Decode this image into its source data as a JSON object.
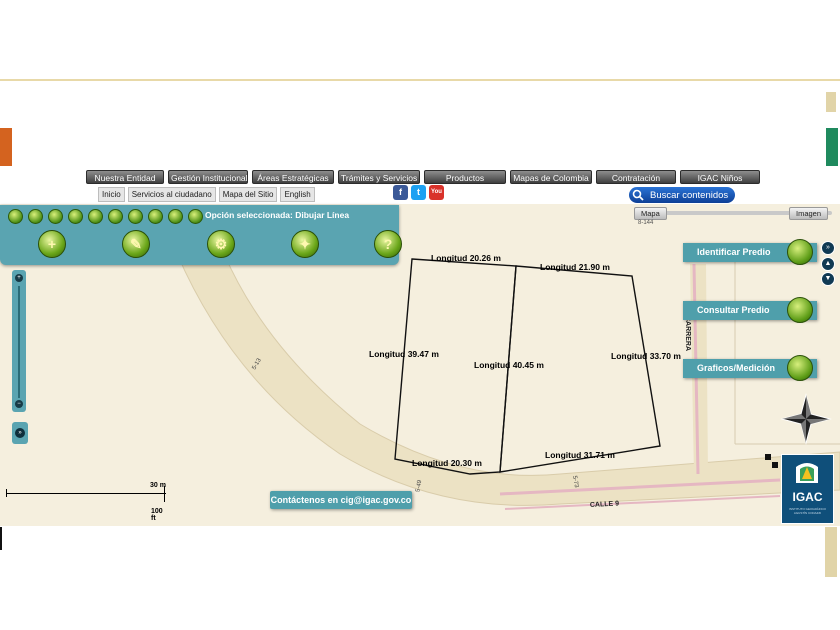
{
  "nav": {
    "items": [
      "Nuestra Entidad",
      "Gestión Institucional",
      "Áreas Estratégicas",
      "Trámites y Servicios",
      "Productos",
      "Mapas de Colombia",
      "Contratación",
      "IGAC Niños"
    ]
  },
  "subnav": {
    "items": [
      "Inicio",
      "Servicios al ciudadano",
      "Mapa del Sitio",
      "English"
    ]
  },
  "social": {
    "facebook": "f",
    "twitter": "t",
    "youtube": "You"
  },
  "search": {
    "label": "Buscar contenidos"
  },
  "toolbar": {
    "selected_option": "Opción seleccionada: Dibujar Línea",
    "big_tools": [
      "+",
      "✎",
      "⚙",
      "✦",
      "?"
    ]
  },
  "layers": {
    "map_label": "Mapa",
    "image_label": "Imagen",
    "small_text": "8-144"
  },
  "panel": {
    "identify": "Identificar Predio",
    "consult": "Consultar Predio",
    "graphics": "Graficos/Medición"
  },
  "measurements": {
    "top_left": "Longitud 20.26 m",
    "top_right": "Longitud 21.90 m",
    "left": "Longitud 39.47 m",
    "middle": "Longitud 40.45 m",
    "right": "Longitud 33.70 m",
    "bottom_left": "Longitud 20.30 m",
    "bottom_right": "Longitud 31.71 m"
  },
  "street_labels": {
    "carrera": "CARRERA",
    "calle": "CALLE 9",
    "label_513": "5-13",
    "label_549": "5-49",
    "label_573": "5-73"
  },
  "scale": {
    "top": "30 m",
    "bottom": "100 ft"
  },
  "contact": {
    "label": "Contáctenos en cig@igac.gov.co"
  },
  "logo": {
    "name": "IGAC",
    "subtitle": "INSTITUTO GEOGRÁFICO AGUSTÍN CODAZZI"
  },
  "colors": {
    "panel": "#5aa4b1",
    "button_green": "#6aa619",
    "map_bg": "#f5efde",
    "road": "#ece2c4",
    "road_pink": "#e5b7c2"
  },
  "icons": [
    "zoom-in-icon",
    "zoom-out-icon",
    "pan-icon",
    "home-icon",
    "globe-icon",
    "hand-icon",
    "info-icon",
    "back-icon",
    "ruler-icon",
    "help-icon",
    "compass-icon",
    "search-icon",
    "house-icon",
    "ruler-icon"
  ]
}
